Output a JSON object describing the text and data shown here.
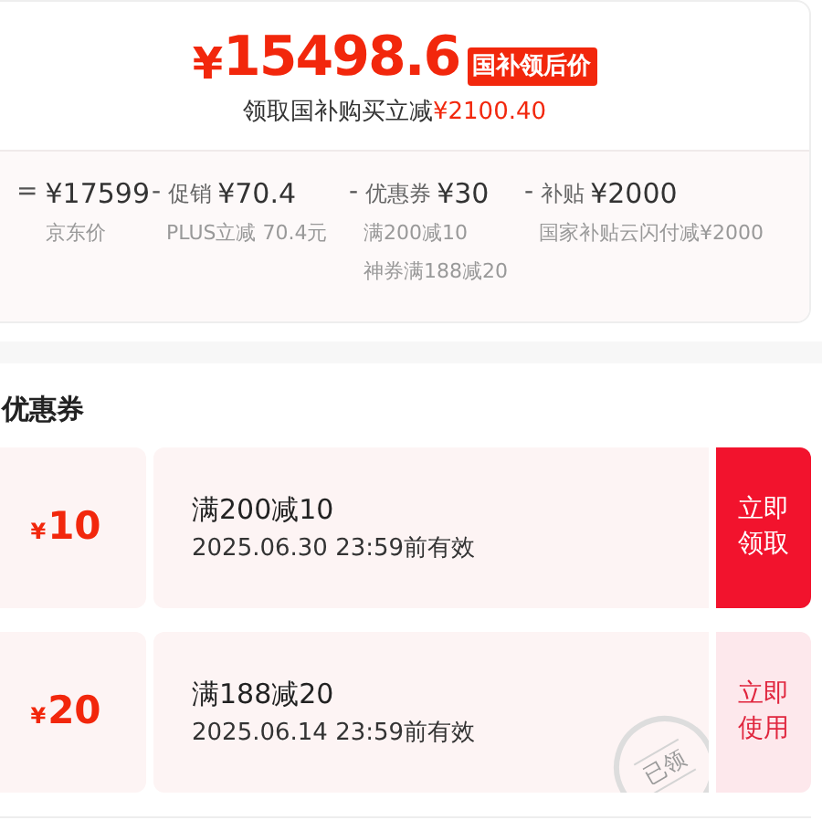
{
  "price_card": {
    "currency": "¥",
    "price": "15498.6",
    "price_tag": "国补领后价",
    "subsidy_label": "领取国补购买立减",
    "subsidy_amount": "¥2100.40",
    "breakdown": [
      {
        "operator": "=",
        "amount": "¥17599",
        "notes": [
          "京东价"
        ]
      },
      {
        "operator": "-",
        "label": "促销",
        "amount": "¥70.4",
        "notes": [
          "PLUS立减 70.4元"
        ]
      },
      {
        "operator": "-",
        "label": "优惠券",
        "amount": "¥30",
        "notes": [
          "满200减10",
          "神券满188减20"
        ]
      },
      {
        "operator": "-",
        "label": "补贴",
        "amount": "¥2000",
        "notes": [
          "国家补贴云闪付减¥2000"
        ]
      }
    ]
  },
  "coupons_section": {
    "title": "优惠券",
    "coupons": [
      {
        "currency": "¥",
        "amount": "10",
        "condition": "满200减10",
        "validity": "2025.06.30 23:59前有效",
        "action": "立即领取",
        "claimed": false
      },
      {
        "currency": "¥",
        "amount": "20",
        "condition": "满188减20",
        "validity": "2025.06.14 23:59前有效",
        "action": "立即使用",
        "claimed": true,
        "stamp": "已领"
      }
    ]
  }
}
